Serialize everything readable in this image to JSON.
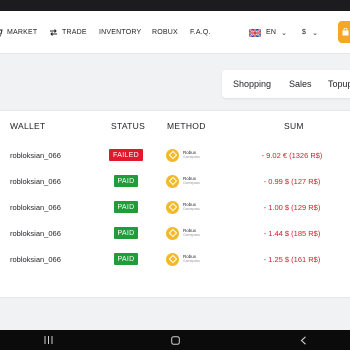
{
  "nav": {
    "items": [
      {
        "label": "MARKET",
        "icon": "market-icon"
      },
      {
        "label": "TRADE",
        "icon": "trade-arrows-icon"
      },
      {
        "label": "INVENTORY"
      },
      {
        "label": "ROBUX"
      },
      {
        "label": "F.A.Q."
      }
    ],
    "language": {
      "code": "EN",
      "flag": "uk-flag-icon"
    },
    "currency": {
      "symbol": "$"
    },
    "accent_color": "#f5a623"
  },
  "tabs": [
    "Shopping",
    "Sales",
    "Topup"
  ],
  "table": {
    "headers": {
      "wallet": "WALLET",
      "status": "STATUS",
      "method": "METHOD",
      "sum": "SUM"
    },
    "method_label": {
      "name": "Robux",
      "sub": "Gamepass"
    },
    "rows": [
      {
        "wallet": "robloksian_066",
        "status": "FAILED",
        "sum": "- 9.02 € (1326 R$)"
      },
      {
        "wallet": "robloksian_066",
        "status": "PAID",
        "sum": "- 0.99 $ (127 R$)"
      },
      {
        "wallet": "robloksian_066",
        "status": "PAID",
        "sum": "- 1.00 $ (129 R$)"
      },
      {
        "wallet": "robloksian_066",
        "status": "PAID",
        "sum": "- 1.44 $ (185 R$)"
      },
      {
        "wallet": "robloksian_066",
        "status": "PAID",
        "sum": "- 1.25 $ (161 R$)"
      }
    ],
    "status_colors": {
      "FAILED": "#e1192e",
      "PAID": "#1f9d3a"
    },
    "sum_color": "#d8182b"
  },
  "system_bar": {
    "icons": [
      "recent-apps-icon",
      "home-icon",
      "back-icon"
    ]
  }
}
